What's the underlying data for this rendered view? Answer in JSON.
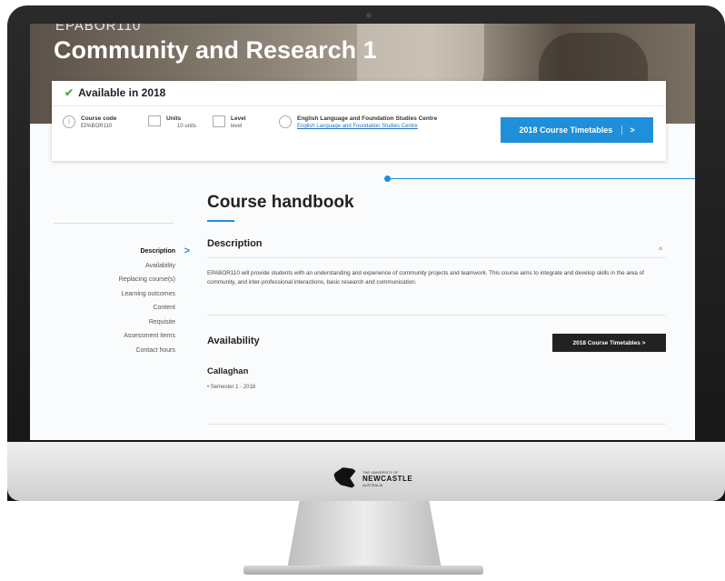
{
  "hero": {
    "course_code": "EPABOR110",
    "title": "Community and Research 1"
  },
  "availability_card": {
    "heading": "Available in 2018",
    "course_code_label": "Course code",
    "course_code_value": "EPABOR110",
    "units_label": "Units",
    "units_value": "10 units",
    "level_label": "Level",
    "level_value": "level",
    "faculty_label": "English Language and Foundation Studies Centre",
    "faculty_link": "English Language and Foundation Studies Centre",
    "timetable_button": "2018 Course Timetables",
    "timetable_chevron": ">"
  },
  "sidenav": {
    "items": [
      {
        "label": "Description"
      },
      {
        "label": "Availability"
      },
      {
        "label": "Replacing course(s)"
      },
      {
        "label": "Learning outcomes"
      },
      {
        "label": "Content"
      },
      {
        "label": "Requisite"
      },
      {
        "label": "Assessment items"
      },
      {
        "label": "Contact hours"
      }
    ],
    "active_chevron": ">"
  },
  "main": {
    "handbook_title": "Course handbook",
    "description_heading": "Description",
    "collapse_caret": "^",
    "description_text": "EPABOR110 will provide students with an understanding and experience of community projects and teamwork. This course aims to integrate and develop skills in the area of community, and inter-professional interactions, basic research and communication.",
    "availability_heading": "Availability",
    "availability_button": "2018 Course Timetables >",
    "campus": "Callaghan",
    "semester": "•  Semester 1 - 2018"
  },
  "monitor": {
    "logo_small": "THE UNIVERSITY OF",
    "logo_big": "NEWCASTLE",
    "logo_country": "AUSTRALIA"
  },
  "colors": {
    "accent": "#1e8fd8",
    "available": "#4caf50",
    "dark_button": "#222222"
  }
}
